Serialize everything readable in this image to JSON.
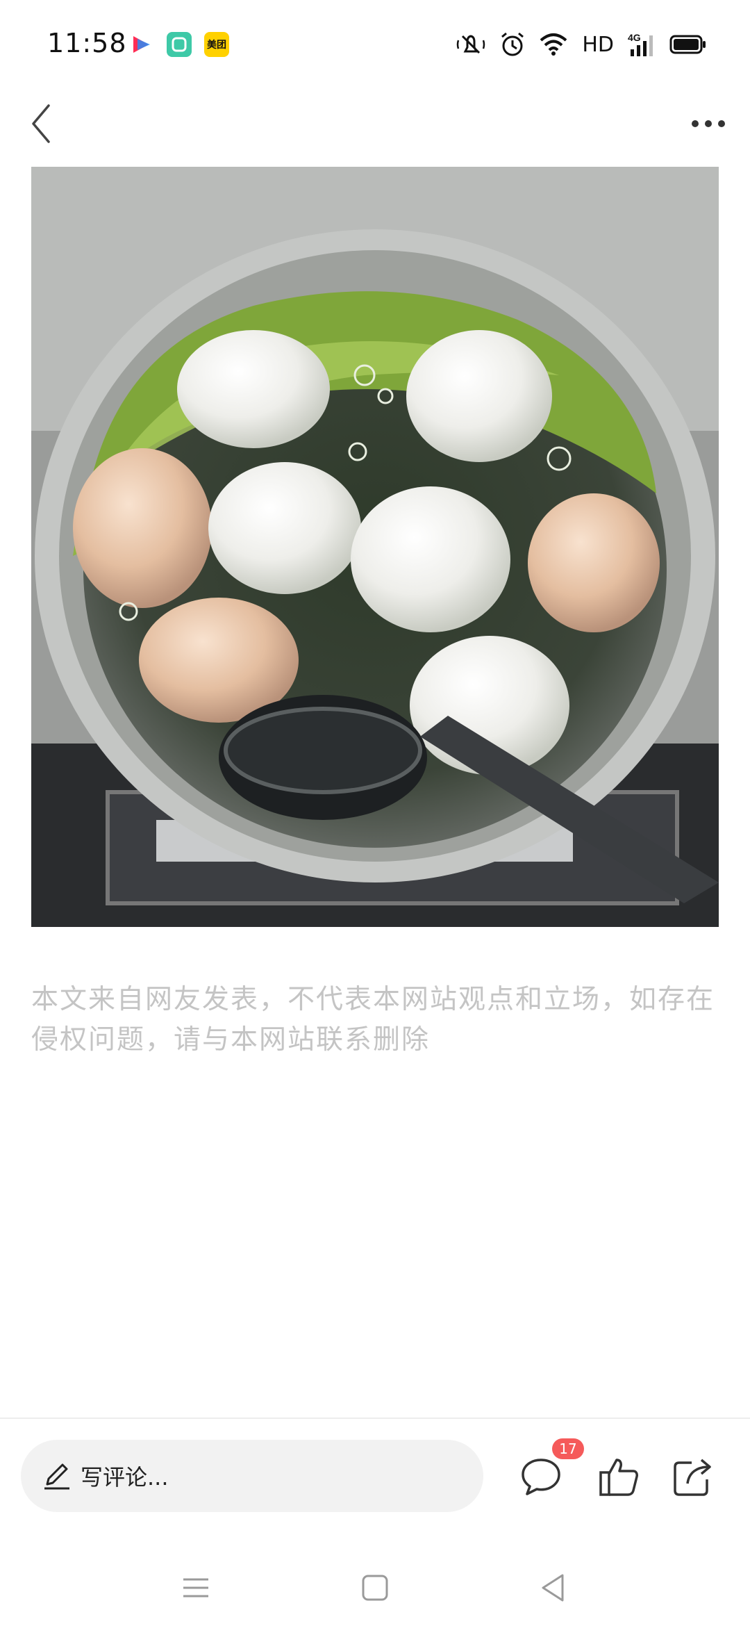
{
  "status_bar": {
    "time": "11:58",
    "network_label": "HD",
    "icons": [
      "video-app-icon",
      "green-app-icon",
      "meituan-app-icon",
      "mute-icon",
      "alarm-icon",
      "wifi-icon",
      "signal-4g-icon",
      "battery-icon"
    ],
    "meituan_label": "美团"
  },
  "header": {
    "back_icon": "chevron-left-icon",
    "more_icon": "more-dots-icon"
  },
  "article": {
    "image_description_name": "eggs-boiling-in-pot-photo",
    "disclaimer": "本文来自网友发表，不代表本网站观点和立场，如存在侵权问题，请与本网站联系删除"
  },
  "bottom_bar": {
    "comment_placeholder": "写评论...",
    "comment_count": "17"
  },
  "colors": {
    "badge": "#f55a5a",
    "disclaimer_text": "#c4c4c4",
    "comment_box_bg": "#f2f2f2"
  }
}
